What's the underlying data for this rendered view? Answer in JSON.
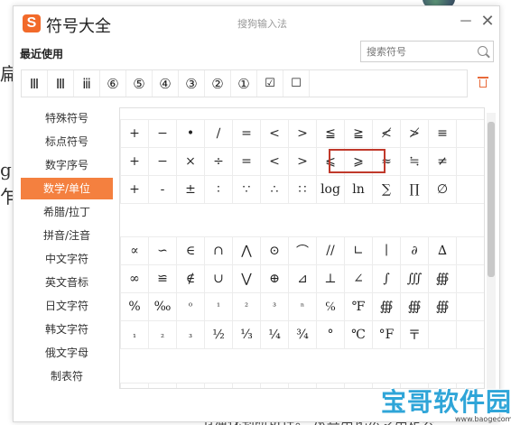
{
  "window": {
    "logo_letter": "S",
    "title": "符号大全",
    "subtitle": "搜狗输入法",
    "minimize_label": "－",
    "close_label": "✕"
  },
  "recent": {
    "label": "最近使用",
    "items": [
      "Ⅲ",
      "Ⅲ",
      "ⅲ",
      "⑥",
      "⑤",
      "④",
      "③",
      "②",
      "①",
      "☑",
      "☐"
    ]
  },
  "search": {
    "placeholder": "搜索符号"
  },
  "sidebar": {
    "items": [
      {
        "label": "特殊符号"
      },
      {
        "label": "标点符号"
      },
      {
        "label": "数字序号"
      },
      {
        "label": "数学/单位"
      },
      {
        "label": "希腊/拉丁"
      },
      {
        "label": "拼音/注音"
      },
      {
        "label": "中文字符"
      },
      {
        "label": "英文音标"
      },
      {
        "label": "日文字符"
      },
      {
        "label": "韩文字符"
      },
      {
        "label": "俄文字母"
      },
      {
        "label": "制表符"
      }
    ],
    "active_index": 3
  },
  "symbols_top": [
    [
      "+",
      "−",
      "•",
      "∕",
      "=",
      "<",
      ">",
      "≦",
      "≧",
      "≮",
      "≯",
      "≡",
      ""
    ],
    [
      "+",
      "−",
      "×",
      "÷",
      "=",
      "<",
      ">",
      "⩽",
      "⩾",
      "≈",
      "≒",
      "≠",
      ""
    ],
    [
      "+",
      "-",
      "±",
      "∶",
      "∵",
      "∴",
      "∷",
      "log",
      "ln",
      "∑",
      "∏",
      "∅",
      ""
    ]
  ],
  "symbols_bottom": [
    [
      "∝",
      "∽",
      "∈",
      "∩",
      "⋀",
      "⊙",
      "⌒",
      "//",
      "∟",
      "∣",
      "∂",
      "∆",
      ""
    ],
    [
      "∞",
      "≌",
      "∉",
      "∪",
      "⋁",
      "⊕",
      "⊿",
      "⊥",
      "∠",
      "∫",
      "∭",
      "∰",
      ""
    ],
    [
      "%",
      "‰",
      "⁰",
      "¹",
      "²",
      "³",
      "ⁿ",
      "℅",
      "℉",
      "∰",
      "∰",
      "∰",
      ""
    ],
    [
      "₁",
      "₂",
      "₃",
      "½",
      "⅓",
      "¼",
      "¾",
      "°",
      "℃",
      "°F",
      "〒",
      "",
      ""
    ]
  ],
  "highlighted_symbols": [
    "⩽",
    "⩾"
  ],
  "background": {
    "left_chars": [
      "扁",
      "g",
      "乍"
    ],
    "bottom_line": "节溜找到断讲径。 从其用化法专用定会"
  },
  "watermark": {
    "text": "宝哥软件园",
    "domain": "www.baogecom"
  },
  "colors": {
    "accent": "#f4803f",
    "logo": "#f26a2a",
    "highlight_border": "#c0392b",
    "watermark": "#2fa5d8"
  }
}
